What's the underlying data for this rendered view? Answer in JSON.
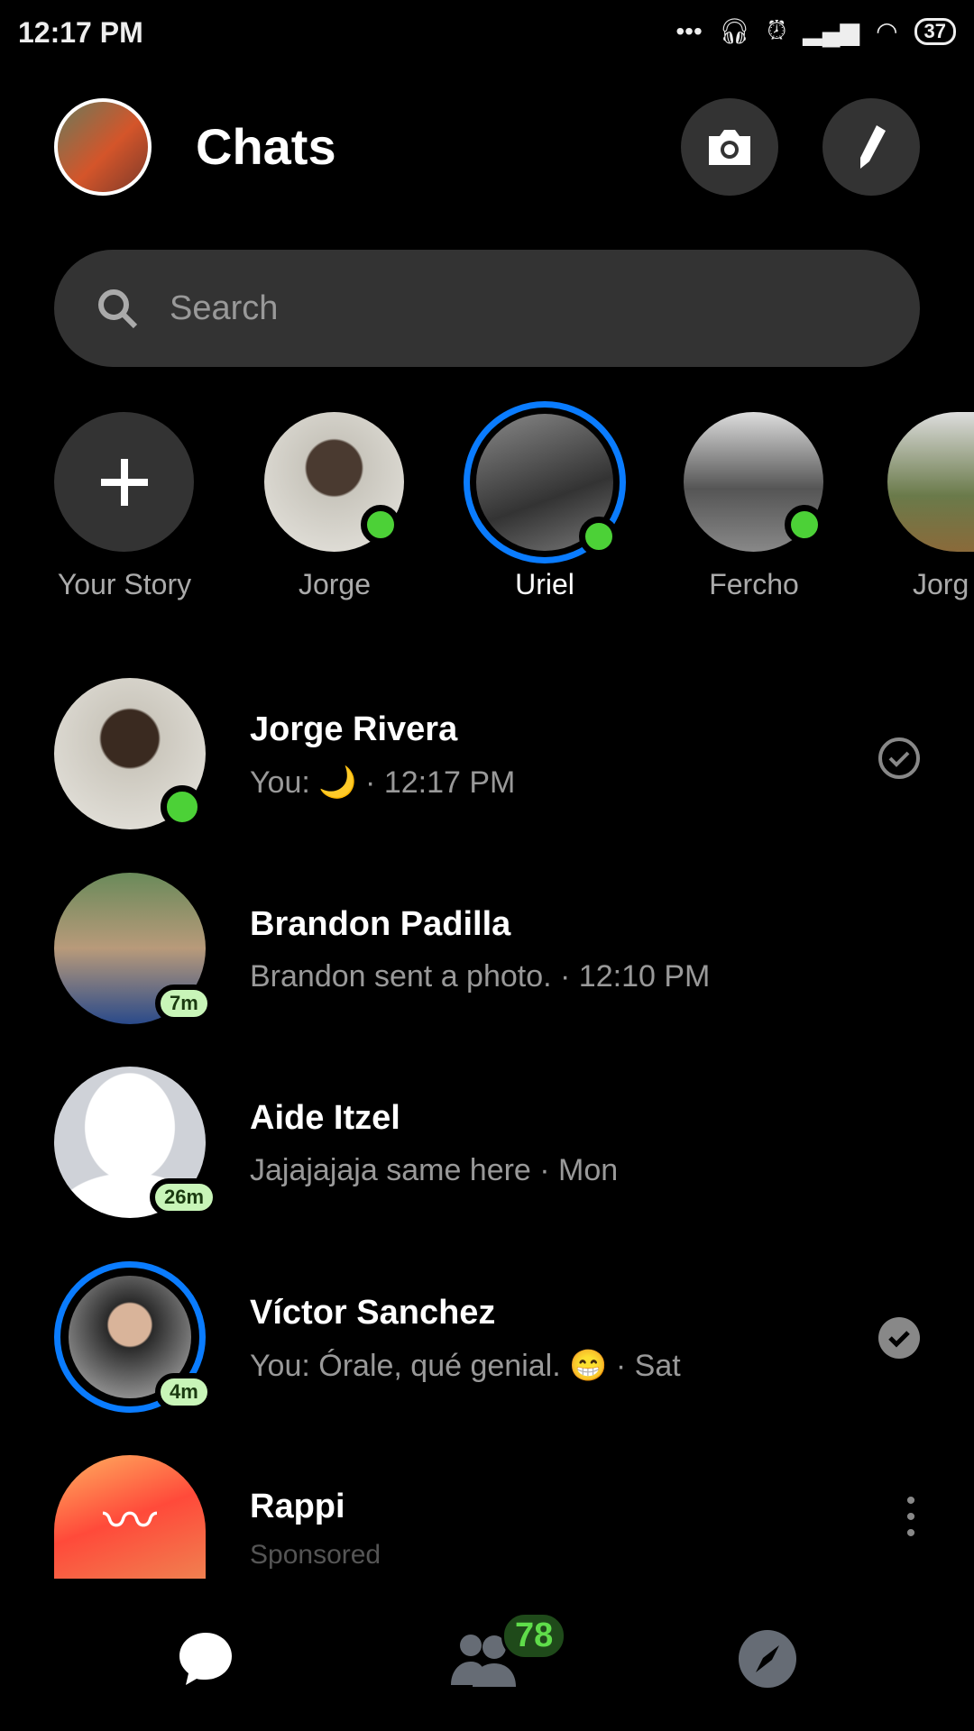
{
  "status": {
    "time": "12:17 PM",
    "battery": "37"
  },
  "header": {
    "title": "Chats"
  },
  "search": {
    "placeholder": "Search"
  },
  "stories": [
    {
      "label": "Your Story"
    },
    {
      "label": "Jorge"
    },
    {
      "label": "Uriel"
    },
    {
      "label": "Fercho"
    },
    {
      "label": "Jorg"
    }
  ],
  "chats": [
    {
      "name": "Jorge Rivera",
      "preview": "You: 🌙 · 12:17 PM"
    },
    {
      "name": "Brandon Padilla",
      "preview": "Brandon sent a photo. · 12:10 PM",
      "badge": "7m"
    },
    {
      "name": "Aide Itzel",
      "preview": "Jajajajaja same here · Mon",
      "badge": "26m"
    },
    {
      "name": "Víctor Sanchez",
      "preview": "You: Órale, qué genial. 😁 · Sat",
      "badge": "4m"
    },
    {
      "name": "Rappi",
      "preview": "Sponsored"
    }
  ],
  "nav": {
    "people_badge": "78"
  },
  "colors": {
    "accent": "#0a7cff",
    "online": "#4cd137"
  }
}
